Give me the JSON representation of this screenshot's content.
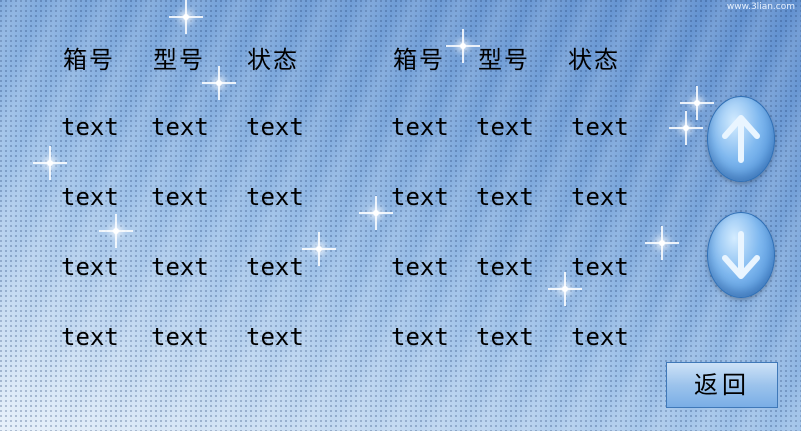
{
  "watermark": "www.3lian.com",
  "columns_left": [
    "箱号",
    "型号",
    "状态"
  ],
  "columns_right": [
    "箱号",
    "型号",
    "状态"
  ],
  "rows_left": [
    [
      "text",
      "text",
      "text"
    ],
    [
      "text",
      "text",
      "text"
    ],
    [
      "text",
      "text",
      "text"
    ],
    [
      "text",
      "text",
      "text"
    ]
  ],
  "rows_right": [
    [
      "text",
      "text",
      "text"
    ],
    [
      "text",
      "text",
      "text"
    ],
    [
      "text",
      "text",
      "text"
    ],
    [
      "text",
      "text",
      "text"
    ]
  ],
  "buttons": {
    "scroll_up_icon": "arrow-up-icon",
    "scroll_down_icon": "arrow-down-icon",
    "back_label": "返回"
  },
  "colors": {
    "background_top": "#5f8fcf",
    "background_bottom": "#e6f0fa",
    "button_fill": "#7fb8ef",
    "text": "#000000"
  }
}
